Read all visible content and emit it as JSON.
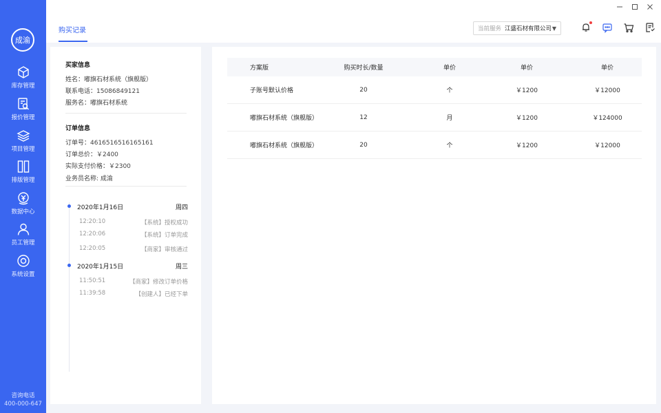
{
  "sidebar": {
    "avatar_text": "成渝",
    "items": [
      {
        "label": "库存管理",
        "icon": "cube-icon"
      },
      {
        "label": "报价管理",
        "icon": "quote-search-icon"
      },
      {
        "label": "项目管理",
        "icon": "layers-icon"
      },
      {
        "label": "排版管理",
        "icon": "layout-icon"
      },
      {
        "label": "数据中心",
        "icon": "data-coin-icon"
      },
      {
        "label": "员工管理",
        "icon": "user-icon"
      },
      {
        "label": "系统设置",
        "icon": "settings-icon"
      }
    ],
    "contact_label": "咨询电话",
    "contact_phone": "400-000-647"
  },
  "header": {
    "tab_label": "购买记录",
    "service_label": "当前服务",
    "service_value": "江盛石材有限公司",
    "icons": [
      "bell-icon",
      "chat-icon",
      "cart-icon",
      "document-icon"
    ],
    "window_controls": [
      "minimize-icon",
      "maximize-icon",
      "close-icon"
    ]
  },
  "buyer": {
    "title": "买家信息",
    "name": "姓名：嘟旗石材系统（旗舰版）",
    "phone": "联系电话：15086849121",
    "service": "服务名：嘟旗石材系统"
  },
  "order": {
    "title": "订单信息",
    "number": "订单号：4616516516165161",
    "total": "订单总价：￥2400",
    "paid": "实际支付价格：￥2300",
    "salesman": "业务员名称: 成渝"
  },
  "timeline": [
    {
      "date": "2020年1月16日",
      "weekday": "周四",
      "events": [
        {
          "time": "12:20:10",
          "text": "【系统】授权成功"
        },
        {
          "time": "12:20:06",
          "text": "【系统】订单完成"
        },
        {
          "time": "12:20:05",
          "text": "【商家】审核通过"
        }
      ]
    },
    {
      "date": "2020年1月15日",
      "weekday": "周三",
      "events": [
        {
          "time": "11:50:51",
          "text": "【商家】修改订单价格"
        },
        {
          "time": "11:39:58",
          "text": "【创建人】已经下单"
        }
      ]
    }
  ],
  "table": {
    "headers": [
      "方案版",
      "购买时长/数量",
      "单价",
      "单价",
      "单价"
    ],
    "rows": [
      [
        "子账号默认价格",
        "20",
        "个",
        "￥1200",
        "￥12000"
      ],
      [
        "嘟旗石材系统（旗舰版）",
        "12",
        "月",
        "￥1200",
        "￥124000"
      ],
      [
        "嘟旗石材系统（旗舰版）",
        "20",
        "个",
        "￥1200",
        "￥12000"
      ]
    ]
  },
  "colors": {
    "accent": "#3a66f0",
    "background": "#f2f4f9",
    "badge": "#f04040"
  }
}
